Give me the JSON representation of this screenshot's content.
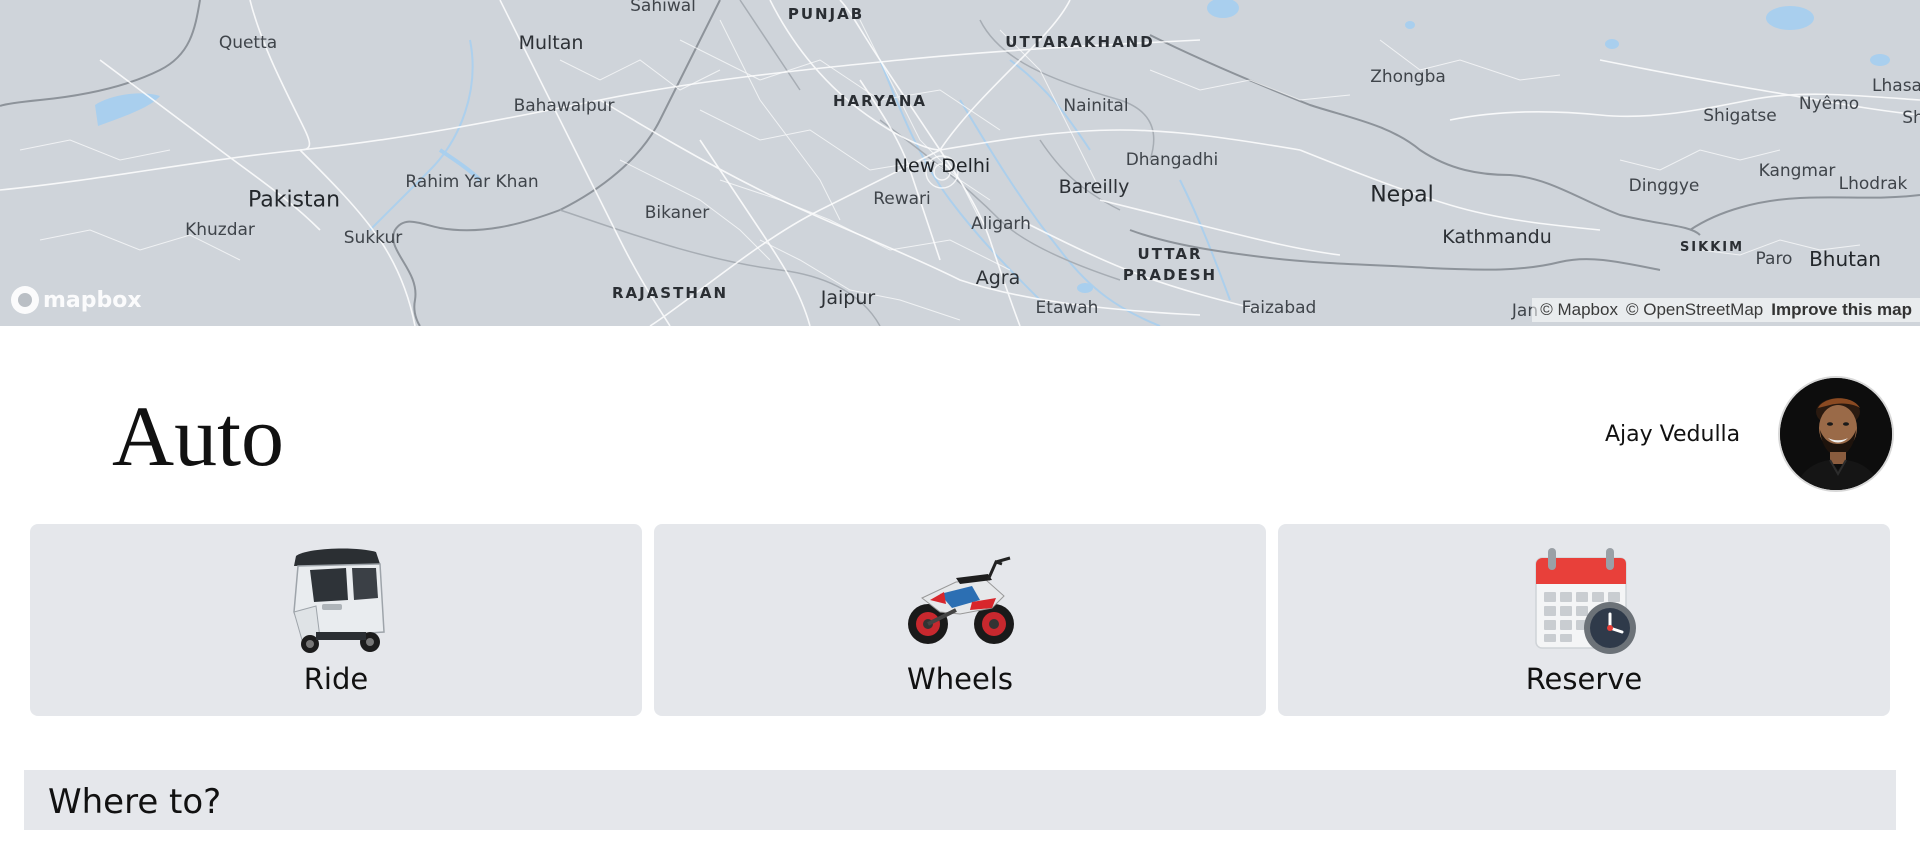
{
  "map": {
    "labels": {
      "sahiwal": "Sahiwal",
      "punjab": "PUNJAB",
      "uttarakhand": "UTTARAKHAND",
      "quetta": "Quetta",
      "multan": "Multan",
      "zhongba": "Zhongba",
      "lhasa": "Lhasa",
      "haryana": "HARYANA",
      "nainital": "Nainital",
      "bahawalpur": "Bahawalpur",
      "nyemo": "Nyêmo",
      "shigatse": "Shigatse",
      "sh": "Sh",
      "kangmar": "Kangmar",
      "dhangadhi": "Dhangadhi",
      "new_delhi": "New Delhi",
      "pakistan": "Pakistan",
      "rahim_yar_khan": "Rahim Yar Khan",
      "bareilly": "Bareilly",
      "dinggye": "Dinggye",
      "lhodrak": "Lhodrak",
      "nepal": "Nepal",
      "rewari": "Rewari",
      "bikaner": "Bikaner",
      "aligarh": "Aligarh",
      "khuzdar": "Khuzdar",
      "sukkur": "Sukkur",
      "kathmandu": "Kathmandu",
      "sikkim": "SIKKIM",
      "paro": "Paro",
      "bhutan": "Bhutan",
      "uttar": "UTTAR",
      "pradesh": "PRADESH",
      "agra": "Agra",
      "rajasthan": "RAJASTHAN",
      "jaipur": "Jaipur",
      "etawah": "Etawah",
      "faizabad": "Faizabad",
      "jan": "Jan"
    },
    "logo_text": "mapbox",
    "attribution": {
      "mapbox": "© Mapbox",
      "osm": "© OpenStreetMap",
      "improve": "Improve this map"
    }
  },
  "header": {
    "brand": "Auto",
    "user_name": "Ajay Vedulla"
  },
  "services": [
    {
      "label": "Ride",
      "icon": "auto-rickshaw-icon"
    },
    {
      "label": "Wheels",
      "icon": "motorcycle-icon"
    },
    {
      "label": "Reserve",
      "icon": "calendar-clock-icon"
    }
  ],
  "search": {
    "placeholder": "Where to?"
  },
  "colors": {
    "map_land": "#cfd4da",
    "card_bg": "#e5e7eb",
    "calendar_red": "#e8403a"
  }
}
